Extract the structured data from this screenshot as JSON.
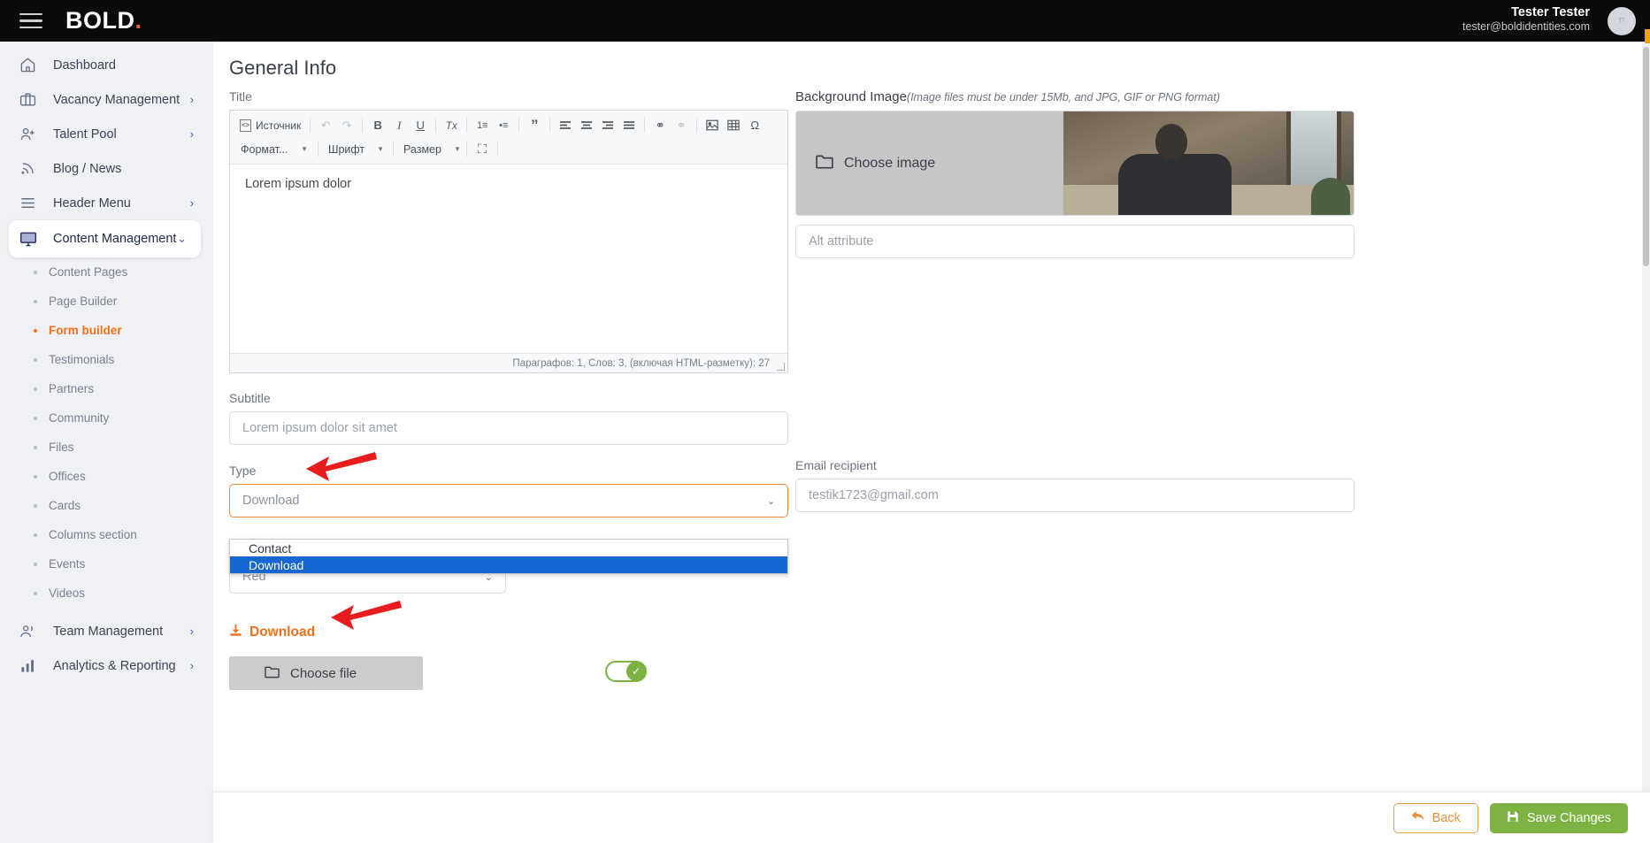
{
  "topbar": {
    "menu_icon": "hamburger-icon",
    "logo_text": "BOLD",
    "logo_dot": ".",
    "user_name": "Tester Tester",
    "user_email": "tester@boldidentities.com",
    "avatar_initials": "TT"
  },
  "sidebar": {
    "items": [
      {
        "label": "Dashboard",
        "icon": "home-icon",
        "chevron": "",
        "active": false
      },
      {
        "label": "Vacancy Management",
        "icon": "briefcase-icon",
        "chevron": "›",
        "active": false
      },
      {
        "label": "Talent Pool",
        "icon": "user-plus-icon",
        "chevron": "›",
        "active": false
      },
      {
        "label": "Blog / News",
        "icon": "rss-icon",
        "chevron": "",
        "active": false
      },
      {
        "label": "Header Menu",
        "icon": "menu-lines-icon",
        "chevron": "›",
        "active": false
      },
      {
        "label": "Content Management",
        "icon": "monitor-icon",
        "chevron": "⌄",
        "active": true
      }
    ],
    "subitems": [
      {
        "label": "Content Pages",
        "current": false
      },
      {
        "label": "Page Builder",
        "current": false
      },
      {
        "label": "Form builder",
        "current": true
      },
      {
        "label": "Testimonials",
        "current": false
      },
      {
        "label": "Partners",
        "current": false
      },
      {
        "label": "Community",
        "current": false
      },
      {
        "label": "Files",
        "current": false
      },
      {
        "label": "Offices",
        "current": false
      },
      {
        "label": "Cards",
        "current": false
      },
      {
        "label": "Columns section",
        "current": false
      },
      {
        "label": "Events",
        "current": false
      },
      {
        "label": "Videos",
        "current": false
      }
    ],
    "bottom_items": [
      {
        "label": "Team Management",
        "icon": "users-icon",
        "chevron": "›"
      },
      {
        "label": "Analytics & Reporting",
        "icon": "bar-chart-icon",
        "chevron": "›"
      }
    ]
  },
  "main": {
    "page_title": "General Info",
    "title_label": "Title",
    "editor": {
      "source_label": "Источник",
      "format_label": "Формат...",
      "font_label": "Шрифт",
      "size_label": "Размер",
      "content": "Lorem ipsum dolor",
      "status": "Параграфов: 1, Слов: 3, (включая HTML-разметку): 27",
      "buttons": {
        "undo": "↶",
        "redo": "↷",
        "bold": "B",
        "italic": "I",
        "underline": "U",
        "remove_format": "Tx",
        "numbered_list": "1≡",
        "bulleted_list": "•≡",
        "blockquote": "”",
        "align_left": "≡",
        "align_center": "≡",
        "align_right": "≡",
        "justify": "≡",
        "link": "⚭",
        "unlink": "⚭",
        "image": "❑",
        "table": "⊞",
        "special_char": "Ω",
        "maximize": "⛶"
      }
    },
    "subtitle_label": "Subtitle",
    "subtitle_placeholder": "Lorem ipsum dolor sit amet",
    "type_label": "Type",
    "type_value": "Download",
    "type_options": [
      {
        "label": "Contact",
        "selected": false
      },
      {
        "label": "Download",
        "selected": true
      }
    ],
    "color_value": "Red",
    "download_link_label": "Download",
    "download_icon": "download-icon",
    "choose_file_label": "Choose file",
    "folder_icon": "folder-icon",
    "toggle_state": "on",
    "toggle_check": "✓"
  },
  "right": {
    "bg_label": "Background Image",
    "bg_hint": "(Image files must be under 15Mb, and JPG, GIF or PNG format)",
    "choose_image_label": "Choose image",
    "alt_placeholder": "Alt attribute",
    "email_label": "Email recipient",
    "email_value": "testik1723@gmail.com"
  },
  "footer": {
    "back_label": "Back",
    "back_icon": "back-arrow-icon",
    "save_label": "Save Changes",
    "save_icon": "floppy-disk-icon"
  },
  "annotations": {
    "arrow_color": "#e81c1c",
    "arrow_type_target": "Type dropdown",
    "arrow_download_target": "Download link"
  },
  "colors": {
    "brand_orange": "#f26322",
    "accent_orange": "#f2701a",
    "green": "#7cb342",
    "select_blue": "#1767d2",
    "sidebar_bg": "#eff1f4",
    "topbar_bg": "#0b0b0b"
  }
}
